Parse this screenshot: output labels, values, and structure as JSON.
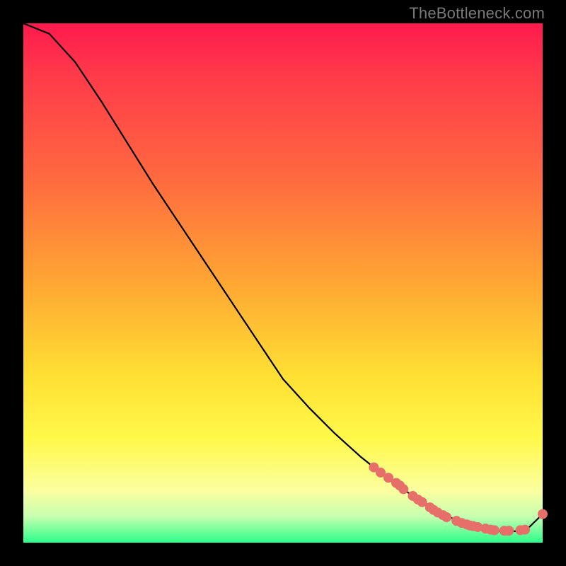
{
  "watermark": "TheBottleneck.com",
  "chart_data": {
    "type": "line",
    "title": "",
    "xlabel": "",
    "ylabel": "",
    "xlim": [
      0,
      100
    ],
    "ylim": [
      0,
      100
    ],
    "series": [
      {
        "name": "curve",
        "x": [
          0,
          5,
          10,
          15,
          20,
          25,
          30,
          35,
          40,
          45,
          50,
          55,
          60,
          65,
          70,
          75,
          80,
          83,
          86,
          89,
          92,
          95,
          97,
          100
        ],
        "y": [
          100,
          98,
          92.5,
          85,
          77,
          69,
          61.5,
          54,
          46.5,
          39,
          31.5,
          26,
          21,
          16.5,
          12.5,
          9,
          6,
          4.5,
          3.4,
          2.6,
          2.2,
          2.2,
          2.6,
          5.5
        ]
      }
    ],
    "markers": {
      "name": "highlight-points",
      "color": "#e76f6a",
      "radius": 7,
      "x": [
        67.5,
        68.8,
        70.3,
        71.8,
        72.5,
        73.2,
        75.0,
        76.0,
        76.8,
        78.3,
        79.0,
        79.8,
        80.8,
        81.5,
        83.4,
        84.4,
        85.4,
        86.0,
        86.6,
        87.5,
        89.0,
        90.0,
        90.7,
        92.6,
        93.5,
        95.7,
        96.6,
        100.0
      ],
      "y": [
        14.5,
        13.5,
        12.5,
        11.5,
        11.0,
        10.3,
        9.0,
        8.3,
        7.8,
        6.8,
        6.3,
        5.8,
        5.3,
        4.9,
        4.2,
        3.8,
        3.5,
        3.3,
        3.2,
        3.0,
        2.7,
        2.5,
        2.4,
        2.3,
        2.3,
        2.4,
        2.5,
        5.5
      ]
    }
  }
}
